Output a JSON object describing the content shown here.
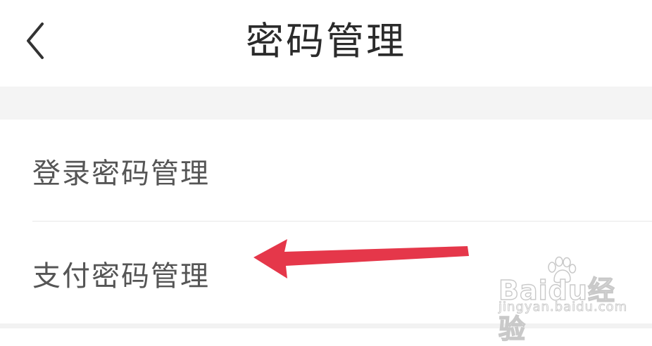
{
  "header": {
    "title": "密码管理",
    "back_icon": "chevron-left-icon"
  },
  "menu": {
    "items": [
      {
        "label": "登录密码管理"
      },
      {
        "label": "支付密码管理"
      }
    ]
  },
  "annotation": {
    "arrow_color": "#e5374a",
    "arrow_icon": "arrow-left-icon"
  },
  "watermark": {
    "brand": "Baidu经验",
    "url": "jingyan.baidu.com"
  }
}
